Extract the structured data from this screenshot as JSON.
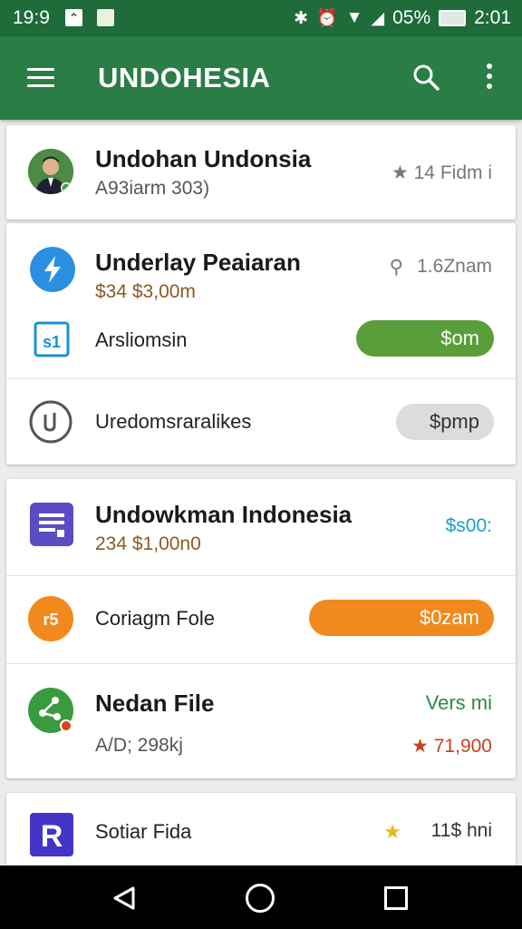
{
  "status_bar": {
    "time": "19:9",
    "battery": "05%",
    "clock": "2:01"
  },
  "app_bar": {
    "title": "UNDOHESIA"
  },
  "cards": [
    {
      "rows": [
        {
          "title": "Undohan Undonsia",
          "subtitle": "A93iarm 303)",
          "meta": "★ 14 Fidm i"
        }
      ]
    },
    {
      "rows": [
        {
          "title": "Underlay Peaiaran",
          "subtitle": "$34 $3,00m",
          "meta": "1.6Znam"
        },
        {
          "label": "Arsliomsin",
          "button": "$om",
          "button_color": "#5a9e3a"
        },
        {
          "label": "Uredomsraralikes",
          "button": "$pmp",
          "button_color": "#dcdcdc"
        }
      ]
    },
    {
      "rows": [
        {
          "title": "Undowkman Indonesia",
          "subtitle": "234 $1,00n0",
          "meta": "$s00:"
        },
        {
          "label": "Coriagm Fole",
          "button": "$0zam",
          "button_color": "#f18a1c"
        },
        {
          "title": "Nedan File",
          "subtitle": "A/D; 298kj",
          "meta_top": "Vers mi",
          "meta": "★ 71,900"
        }
      ]
    },
    {
      "rows": [
        {
          "label": "Sotiar Fida",
          "meta": "11$ hni"
        }
      ]
    }
  ]
}
